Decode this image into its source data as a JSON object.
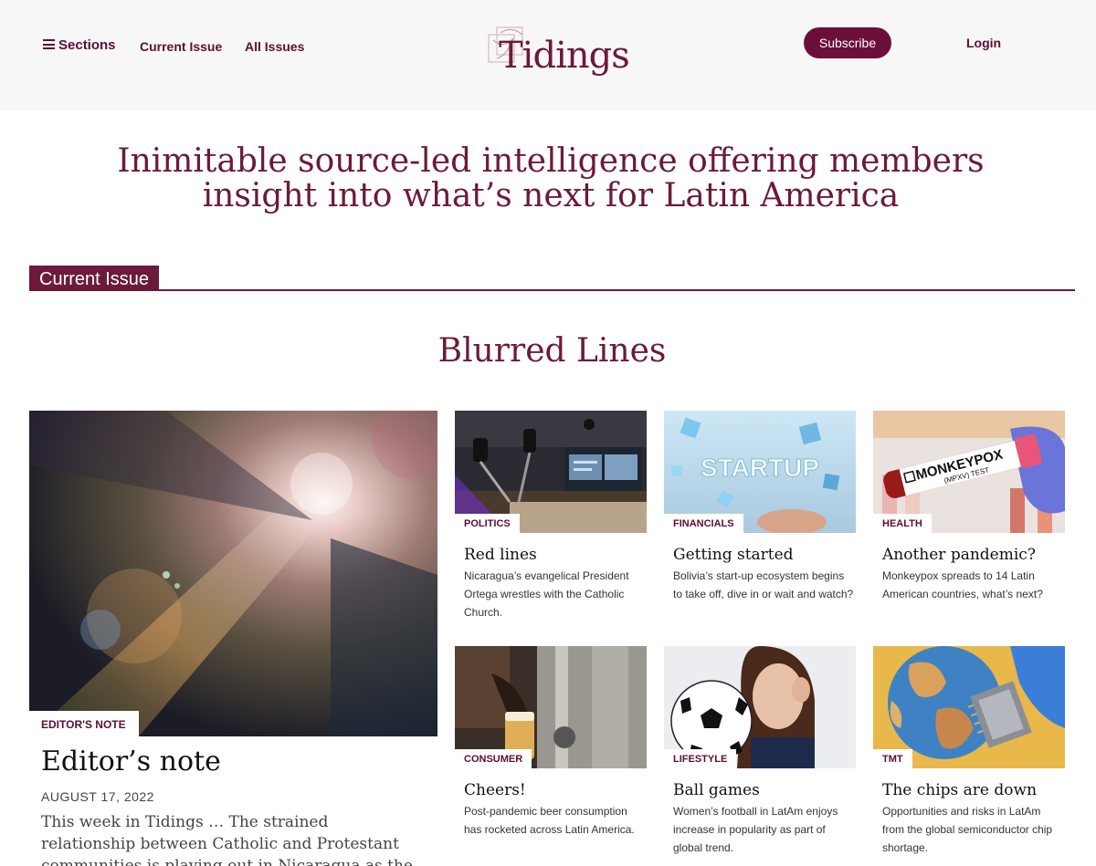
{
  "header": {
    "sections_label": "Sections",
    "current_issue_label": "Current Issue",
    "all_issues_label": "All Issues",
    "logo_text": "Tidings",
    "subscribe_label": "Subscribe",
    "login_label": "Login"
  },
  "tagline": {
    "line1": "Inimitable source-led intelligence offering members",
    "line2": "insight into what’s next for Latin America"
  },
  "current_issue": {
    "label": "Current Issue",
    "title": "Blurred Lines"
  },
  "feature": {
    "tag": "EDITOR'S NOTE",
    "title": "Editor’s note",
    "date": "AUGUST 17, 2022",
    "excerpt": "This week in Tidings … The strained relationship between Catholic and Protestant communities is playing out in Nicaragua as the"
  },
  "cards": [
    {
      "tag": "POLITICS",
      "title": "Red lines",
      "desc": "Nicaragua’s evangelical President Ortega wrestles with the Catholic Church."
    },
    {
      "tag": "FINANCIALS",
      "title": "Getting started",
      "desc": "Bolivia’s start-up ecosystem begins to take off, dive in or wait and watch?",
      "image_text": "STARTUP"
    },
    {
      "tag": "HEALTH",
      "title": "Another pandemic?",
      "desc": "Monkeypox spreads to 14 Latin American countries, what’s next?",
      "image_text": "MONKEYPOX",
      "image_subtext": "(MPXV) TEST"
    },
    {
      "tag": "CONSUMER",
      "title": "Cheers!",
      "desc": "Post-pandemic beer consumption has rocketed across Latin America."
    },
    {
      "tag": "LIFESTYLE",
      "title": "Ball games",
      "desc": "Women’s football in LatAm enjoys increase in popularity as part of global trend."
    },
    {
      "tag": "TMT",
      "title": "The chips are down",
      "desc": "Opportunities and risks in LatAm from the global semiconductor chip shortage."
    }
  ],
  "colors": {
    "brand": "#6b1a3c",
    "header_bg": "#f7f7f7"
  }
}
